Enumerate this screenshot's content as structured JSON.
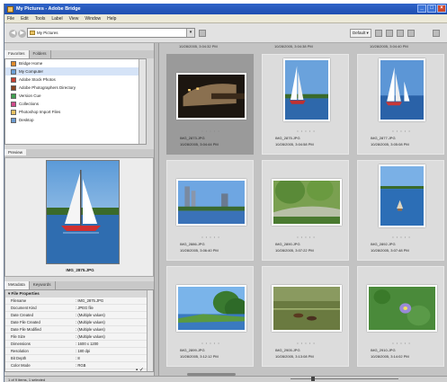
{
  "window": {
    "title": "My Pictures - Adobe Bridge"
  },
  "menu": [
    "File",
    "Edit",
    "Tools",
    "Label",
    "View",
    "Window",
    "Help"
  ],
  "toolbar": {
    "path": "My Pictures",
    "workspace_label": "Default ▾"
  },
  "favorites": {
    "tabs": [
      "Favorites",
      "Folders"
    ],
    "items": [
      {
        "label": "Bridge Home",
        "color": "#e08a2a"
      },
      {
        "label": "My Computer",
        "color": "#6aa0d8"
      },
      {
        "label": "Adobe Stock Photos",
        "color": "#c84030"
      },
      {
        "label": "Adobe Photographers Directory",
        "color": "#884420"
      },
      {
        "label": "Version Cue",
        "color": "#40a050"
      },
      {
        "label": "Collections",
        "color": "#d04a8a"
      },
      {
        "label": "Photoshop Import Files",
        "color": "#e8c060"
      },
      {
        "label": "Desktop",
        "color": "#6a9ad0"
      }
    ]
  },
  "preview": {
    "tab": "Preview",
    "filename": "IMG_2875.JPG"
  },
  "metadata": {
    "tabs": [
      "Metadata",
      "Keywords"
    ],
    "section": "▾ File Properties",
    "rows": [
      {
        "key": "Filename",
        "value": ": IMG_2875.JPG"
      },
      {
        "key": "Document Kind",
        "value": ": JPEG file"
      },
      {
        "key": "Date Created",
        "value": ": (Multiple values)"
      },
      {
        "key": "Date File Created",
        "value": ": (Multiple values)"
      },
      {
        "key": "Date File Modified",
        "value": ": (Multiple values)"
      },
      {
        "key": "File Size",
        "value": ": (Multiple values)"
      },
      {
        "key": "Dimensions",
        "value": ": 1600 x 1200"
      },
      {
        "key": "Resolution",
        "value": ": 180 dpi"
      },
      {
        "key": "Bit Depth",
        "value": ": 8"
      },
      {
        "key": "Color Mode",
        "value": ": RGB"
      }
    ]
  },
  "thumbnails": [
    {
      "name": "IMG_2873.JPG",
      "date": "10/28/2005, 3:04:44 PM",
      "selected": true
    },
    {
      "name": "IMG_2875.JPG",
      "date": "10/28/2005, 3:04:58 PM",
      "selected": false
    },
    {
      "name": "IMG_2877.JPG",
      "date": "10/28/2005, 3:05:08 PM",
      "selected": false
    },
    {
      "name": "IMG_2886.JPG",
      "date": "10/28/2005, 3:06:40 PM",
      "selected": false
    },
    {
      "name": "IMG_2890.JPG",
      "date": "10/28/2005, 3:07:22 PM",
      "selected": false
    },
    {
      "name": "IMG_2892.JPG",
      "date": "10/28/2005, 3:07:48 PM",
      "selected": false
    },
    {
      "name": "IMG_2899.JPG",
      "date": "10/28/2005, 3:12:12 PM",
      "selected": false
    },
    {
      "name": "IMG_2905.JPG",
      "date": "10/28/2005, 3:13:08 PM",
      "selected": false
    },
    {
      "name": "IMG_2910.JPG",
      "date": "10/28/2005, 3:14:02 PM",
      "selected": false
    }
  ],
  "rating_dots": "• • • • •",
  "top_row_dates": [
    "10/28/2005, 3:04:32 PM",
    "10/28/2005, 3:04:38 PM",
    "10/28/2005, 3:04:40 PM"
  ],
  "status": {
    "text": "1 of 9 items, 1 selected",
    "zoom_fraction": 0.2
  }
}
